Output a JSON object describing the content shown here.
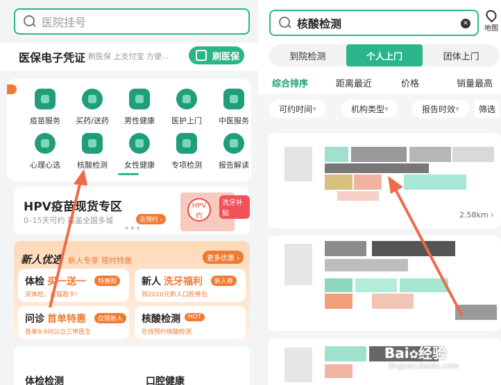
{
  "left": {
    "search": {
      "placeholder": "医院挂号"
    },
    "insurance": {
      "title": "医保电子凭证",
      "subtitle": "刷医保 上支付宝 方便...",
      "button": "刷医保"
    },
    "services": [
      {
        "label": "疫苗服务",
        "icon": "syringe-icon"
      },
      {
        "label": "买药/送药",
        "icon": "pill-icon"
      },
      {
        "label": "男性健康",
        "icon": "male-icon"
      },
      {
        "label": "医护上门",
        "icon": "nurse-icon"
      },
      {
        "label": "中医服务",
        "icon": "herbal-bowl-icon"
      },
      {
        "label": "心理心选",
        "icon": "heart-icon"
      },
      {
        "label": "核酸检测",
        "icon": "test-tube-icon"
      },
      {
        "label": "女性健康",
        "icon": "female-icon"
      },
      {
        "label": "专项检测",
        "icon": "flask-icon"
      },
      {
        "label": "报告解读",
        "icon": "report-icon"
      }
    ],
    "hpv": {
      "title": "HPV疫苗现货专区",
      "subtitle": "0–15天可约 覆盖全国多城",
      "cta": "去预约 ›",
      "badge": "洗牙补贴",
      "envelope_text": "HPV",
      "envelope_sub": "约"
    },
    "promo": {
      "title": "新人优选",
      "sub_1": "新人专享",
      "sub_2": "限时特惠",
      "more": "更多优惠 ›",
      "cards": [
        {
          "t1": "体检",
          "t2": "买一送一",
          "tag": "特惠购",
          "desc": "买体检，送猫超卡!"
        },
        {
          "t1": "新人",
          "t2": "洗牙福利",
          "tag": "新人券",
          "desc": "领2010元新人口腔券包"
        },
        {
          "t1": "问诊",
          "t2": "首单特惠",
          "tag": "仅限新人",
          "desc": "首单9.9问公立三甲医生"
        },
        {
          "t1": "核酸检测",
          "t2": "",
          "tag": "HOT",
          "desc": "在线预约核酸检测"
        }
      ]
    },
    "bottom": {
      "a": "体检检测",
      "b": "口腔健康"
    }
  },
  "right": {
    "search": {
      "value": "核酸检测"
    },
    "map_label": "地图",
    "tabs": [
      "到院检测",
      "个人上门",
      "团体上门"
    ],
    "active_tab": 1,
    "sorts": [
      "综合排序",
      "距离最近",
      "价格",
      "销量最高"
    ],
    "filters": [
      "可约时间",
      "机构类型",
      "报告时效"
    ],
    "filter_label": "筛选",
    "distance": "2.58km ›"
  },
  "watermark": {
    "brand": "Bai",
    "brand2": "经验",
    "url": "jingyan.baidu.com"
  },
  "colors": {
    "accent": "#2bb58a",
    "orange": "#f07a33",
    "arrow": "#ef6a47"
  }
}
